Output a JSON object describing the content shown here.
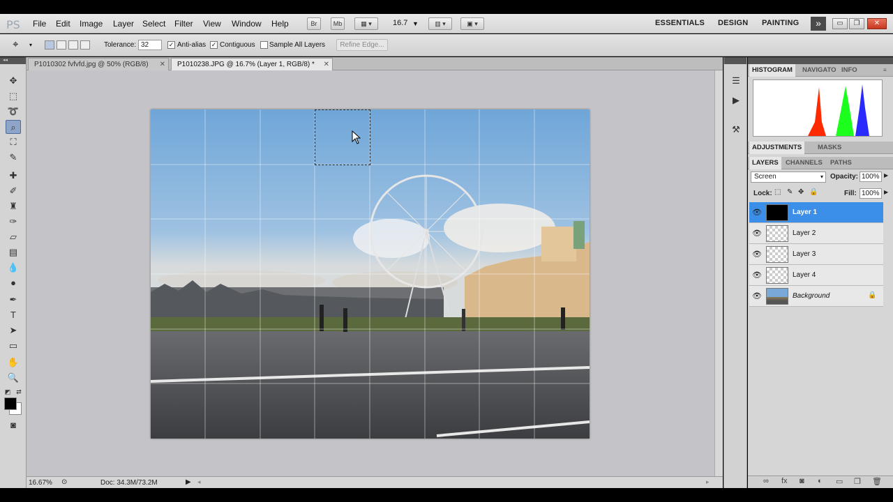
{
  "app": {
    "logo": "PS"
  },
  "menu": [
    "File",
    "Edit",
    "Image",
    "Layer",
    "Select",
    "Filter",
    "View",
    "Window",
    "Help"
  ],
  "appbar": {
    "bridge": "Br",
    "minibridge": "Mb",
    "zoom": "16.7"
  },
  "workspaces": {
    "essentials": "ESSENTIALS",
    "design": "DESIGN",
    "painting": "PAINTING",
    "more": "»"
  },
  "window_buttons": {
    "minimize": "▭",
    "restore": "❐",
    "close": "✕"
  },
  "options": {
    "tolerance_label": "Tolerance:",
    "tolerance_value": "32",
    "antialias_label": "Anti-alias",
    "antialias_checked": true,
    "contiguous_label": "Contiguous",
    "contiguous_checked": true,
    "sample_all_label": "Sample All Layers",
    "sample_all_checked": false,
    "refine_edge": "Refine Edge..."
  },
  "documents": [
    {
      "title": "P1010302 fvfvfd.jpg @ 50% (RGB/8)",
      "active": false
    },
    {
      "title": "P1010238.JPG @ 16.7% (Layer 1, RGB/8) *",
      "active": true
    }
  ],
  "status": {
    "zoom": "16.67%",
    "doc": "Doc: 34.3M/73.2M"
  },
  "panels": {
    "top_tabs": [
      "HISTOGRAM",
      "NAVIGATO",
      "INFO"
    ],
    "adj_tabs": [
      "ADJUSTMENTS",
      "MASKS"
    ],
    "layer_tabs": [
      "LAYERS",
      "CHANNELS",
      "PATHS"
    ],
    "blend_mode": "Screen",
    "opacity_label": "Opacity:",
    "opacity_value": "100%",
    "lock_label": "Lock:",
    "fill_label": "Fill:",
    "fill_value": "100%"
  },
  "layers": [
    {
      "name": "Layer 1",
      "selected": true,
      "thumb": "black"
    },
    {
      "name": "Layer 2",
      "selected": false,
      "thumb": "transparent"
    },
    {
      "name": "Layer 3",
      "selected": false,
      "thumb": "transparent"
    },
    {
      "name": "Layer 4",
      "selected": false,
      "thumb": "transparent"
    },
    {
      "name": "Background",
      "selected": false,
      "thumb": "photo",
      "locked": true
    }
  ],
  "colors": {
    "selected_layer": "#3b8fe8",
    "histogram_red": "#ff2a00",
    "histogram_green": "#1cff1c",
    "histogram_blue": "#2a2aff"
  }
}
